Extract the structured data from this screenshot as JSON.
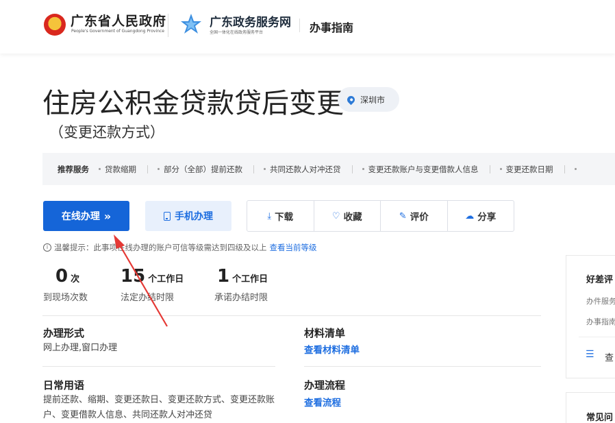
{
  "header": {
    "gov_title": "广东省人民政府",
    "gov_subtitle": "People's Government of Guangdong Province",
    "service_title": "广东政务服务网",
    "service_subtitle": "全国一体化在线政务服务平台",
    "guide_label": "办事指南"
  },
  "page": {
    "title": "住房公积金贷款贷后变更",
    "location": "深圳市",
    "subtitle": "（变更还款方式）"
  },
  "recommend": {
    "label": "推荐服务",
    "items": [
      "贷款缩期",
      "部分（全部）提前还款",
      "共同还款人对冲还贷",
      "变更还款账户与变更借款人信息",
      "变更还款日期"
    ]
  },
  "actions": {
    "online": "在线办理",
    "online_chevron": "»",
    "mobile": "手机办理",
    "download": "下载",
    "favorite": "收藏",
    "rate": "评价",
    "share": "分享"
  },
  "tip": {
    "text": "温馨提示：此事项在线办理的账户可信等级需达到四级及以上",
    "link": "查看当前等级"
  },
  "stats": [
    {
      "num": "0",
      "unit": "次",
      "label": "到现场次数"
    },
    {
      "num": "15",
      "unit": "个工作日",
      "label": "法定办结时限"
    },
    {
      "num": "1",
      "unit": "个工作日",
      "label": "承诺办结时限"
    }
  ],
  "sections": {
    "form_title": "办理形式",
    "form_text": "网上办理,窗口办理",
    "materials_title": "材料清单",
    "materials_link": "查看材料清单",
    "terms_title": "日常用语",
    "terms_text": "提前还款、缩期、变更还款日、变更还款方式、变更还款账户、变更借款人信息、共同还款人对冲还贷",
    "process_title": "办理流程",
    "process_link": "查看流程"
  },
  "side": {
    "rating_title": "好差评",
    "rating_line1": "办件服务",
    "rating_line2": "办事指南",
    "view_text": "查",
    "faq_title": "常见问"
  },
  "colors": {
    "primary": "#1565d8",
    "link": "#1e6ee0",
    "arrow": "#e53935",
    "rec_bg": "#f4f5f7"
  }
}
